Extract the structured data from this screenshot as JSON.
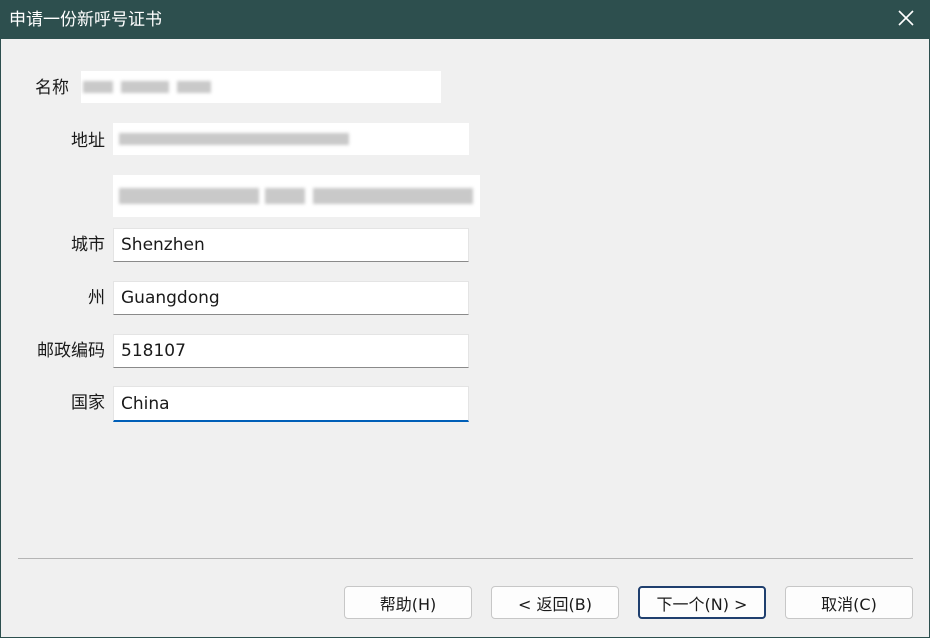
{
  "window": {
    "title": "申请一份新呼号证书"
  },
  "form": {
    "name_label": "名称",
    "address_label": "地址",
    "city_label": "城市",
    "city_value": "Shenzhen",
    "state_label": "州",
    "state_value": "Guangdong",
    "postal_label": "邮政编码",
    "postal_value": "518107",
    "country_label": "国家",
    "country_value": "China"
  },
  "buttons": {
    "help": "帮助(H)",
    "back": "< 返回(B)",
    "next": "下一个(N) >",
    "cancel": "取消(C)"
  },
  "icons": {
    "close": "close-icon"
  },
  "colors": {
    "titlebar": "#2d4f4e",
    "focus_accent": "#005fb8",
    "primary_button_border": "#1f3f6e"
  }
}
